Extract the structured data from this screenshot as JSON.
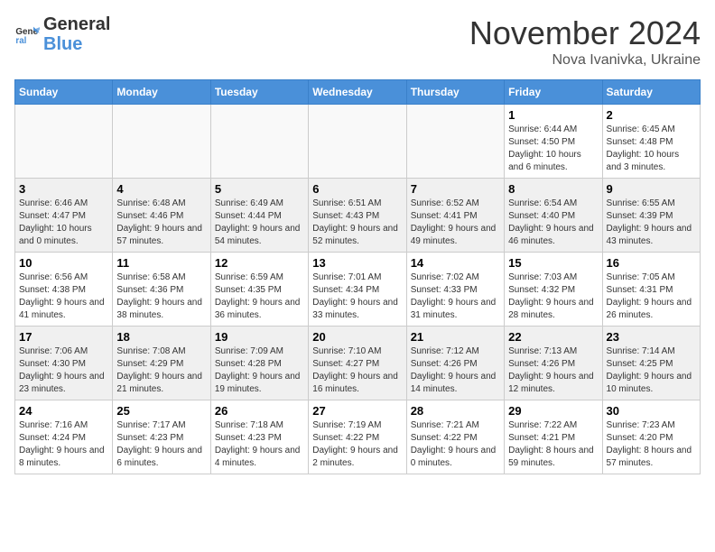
{
  "header": {
    "logo_general": "General",
    "logo_blue": "Blue",
    "month": "November 2024",
    "location": "Nova Ivanivka, Ukraine"
  },
  "days_of_week": [
    "Sunday",
    "Monday",
    "Tuesday",
    "Wednesday",
    "Thursday",
    "Friday",
    "Saturday"
  ],
  "weeks": [
    [
      {
        "day": "",
        "info": ""
      },
      {
        "day": "",
        "info": ""
      },
      {
        "day": "",
        "info": ""
      },
      {
        "day": "",
        "info": ""
      },
      {
        "day": "",
        "info": ""
      },
      {
        "day": "1",
        "info": "Sunrise: 6:44 AM\nSunset: 4:50 PM\nDaylight: 10 hours and 6 minutes."
      },
      {
        "day": "2",
        "info": "Sunrise: 6:45 AM\nSunset: 4:48 PM\nDaylight: 10 hours and 3 minutes."
      }
    ],
    [
      {
        "day": "3",
        "info": "Sunrise: 6:46 AM\nSunset: 4:47 PM\nDaylight: 10 hours and 0 minutes."
      },
      {
        "day": "4",
        "info": "Sunrise: 6:48 AM\nSunset: 4:46 PM\nDaylight: 9 hours and 57 minutes."
      },
      {
        "day": "5",
        "info": "Sunrise: 6:49 AM\nSunset: 4:44 PM\nDaylight: 9 hours and 54 minutes."
      },
      {
        "day": "6",
        "info": "Sunrise: 6:51 AM\nSunset: 4:43 PM\nDaylight: 9 hours and 52 minutes."
      },
      {
        "day": "7",
        "info": "Sunrise: 6:52 AM\nSunset: 4:41 PM\nDaylight: 9 hours and 49 minutes."
      },
      {
        "day": "8",
        "info": "Sunrise: 6:54 AM\nSunset: 4:40 PM\nDaylight: 9 hours and 46 minutes."
      },
      {
        "day": "9",
        "info": "Sunrise: 6:55 AM\nSunset: 4:39 PM\nDaylight: 9 hours and 43 minutes."
      }
    ],
    [
      {
        "day": "10",
        "info": "Sunrise: 6:56 AM\nSunset: 4:38 PM\nDaylight: 9 hours and 41 minutes."
      },
      {
        "day": "11",
        "info": "Sunrise: 6:58 AM\nSunset: 4:36 PM\nDaylight: 9 hours and 38 minutes."
      },
      {
        "day": "12",
        "info": "Sunrise: 6:59 AM\nSunset: 4:35 PM\nDaylight: 9 hours and 36 minutes."
      },
      {
        "day": "13",
        "info": "Sunrise: 7:01 AM\nSunset: 4:34 PM\nDaylight: 9 hours and 33 minutes."
      },
      {
        "day": "14",
        "info": "Sunrise: 7:02 AM\nSunset: 4:33 PM\nDaylight: 9 hours and 31 minutes."
      },
      {
        "day": "15",
        "info": "Sunrise: 7:03 AM\nSunset: 4:32 PM\nDaylight: 9 hours and 28 minutes."
      },
      {
        "day": "16",
        "info": "Sunrise: 7:05 AM\nSunset: 4:31 PM\nDaylight: 9 hours and 26 minutes."
      }
    ],
    [
      {
        "day": "17",
        "info": "Sunrise: 7:06 AM\nSunset: 4:30 PM\nDaylight: 9 hours and 23 minutes."
      },
      {
        "day": "18",
        "info": "Sunrise: 7:08 AM\nSunset: 4:29 PM\nDaylight: 9 hours and 21 minutes."
      },
      {
        "day": "19",
        "info": "Sunrise: 7:09 AM\nSunset: 4:28 PM\nDaylight: 9 hours and 19 minutes."
      },
      {
        "day": "20",
        "info": "Sunrise: 7:10 AM\nSunset: 4:27 PM\nDaylight: 9 hours and 16 minutes."
      },
      {
        "day": "21",
        "info": "Sunrise: 7:12 AM\nSunset: 4:26 PM\nDaylight: 9 hours and 14 minutes."
      },
      {
        "day": "22",
        "info": "Sunrise: 7:13 AM\nSunset: 4:26 PM\nDaylight: 9 hours and 12 minutes."
      },
      {
        "day": "23",
        "info": "Sunrise: 7:14 AM\nSunset: 4:25 PM\nDaylight: 9 hours and 10 minutes."
      }
    ],
    [
      {
        "day": "24",
        "info": "Sunrise: 7:16 AM\nSunset: 4:24 PM\nDaylight: 9 hours and 8 minutes."
      },
      {
        "day": "25",
        "info": "Sunrise: 7:17 AM\nSunset: 4:23 PM\nDaylight: 9 hours and 6 minutes."
      },
      {
        "day": "26",
        "info": "Sunrise: 7:18 AM\nSunset: 4:23 PM\nDaylight: 9 hours and 4 minutes."
      },
      {
        "day": "27",
        "info": "Sunrise: 7:19 AM\nSunset: 4:22 PM\nDaylight: 9 hours and 2 minutes."
      },
      {
        "day": "28",
        "info": "Sunrise: 7:21 AM\nSunset: 4:22 PM\nDaylight: 9 hours and 0 minutes."
      },
      {
        "day": "29",
        "info": "Sunrise: 7:22 AM\nSunset: 4:21 PM\nDaylight: 8 hours and 59 minutes."
      },
      {
        "day": "30",
        "info": "Sunrise: 7:23 AM\nSunset: 4:20 PM\nDaylight: 8 hours and 57 minutes."
      }
    ]
  ]
}
